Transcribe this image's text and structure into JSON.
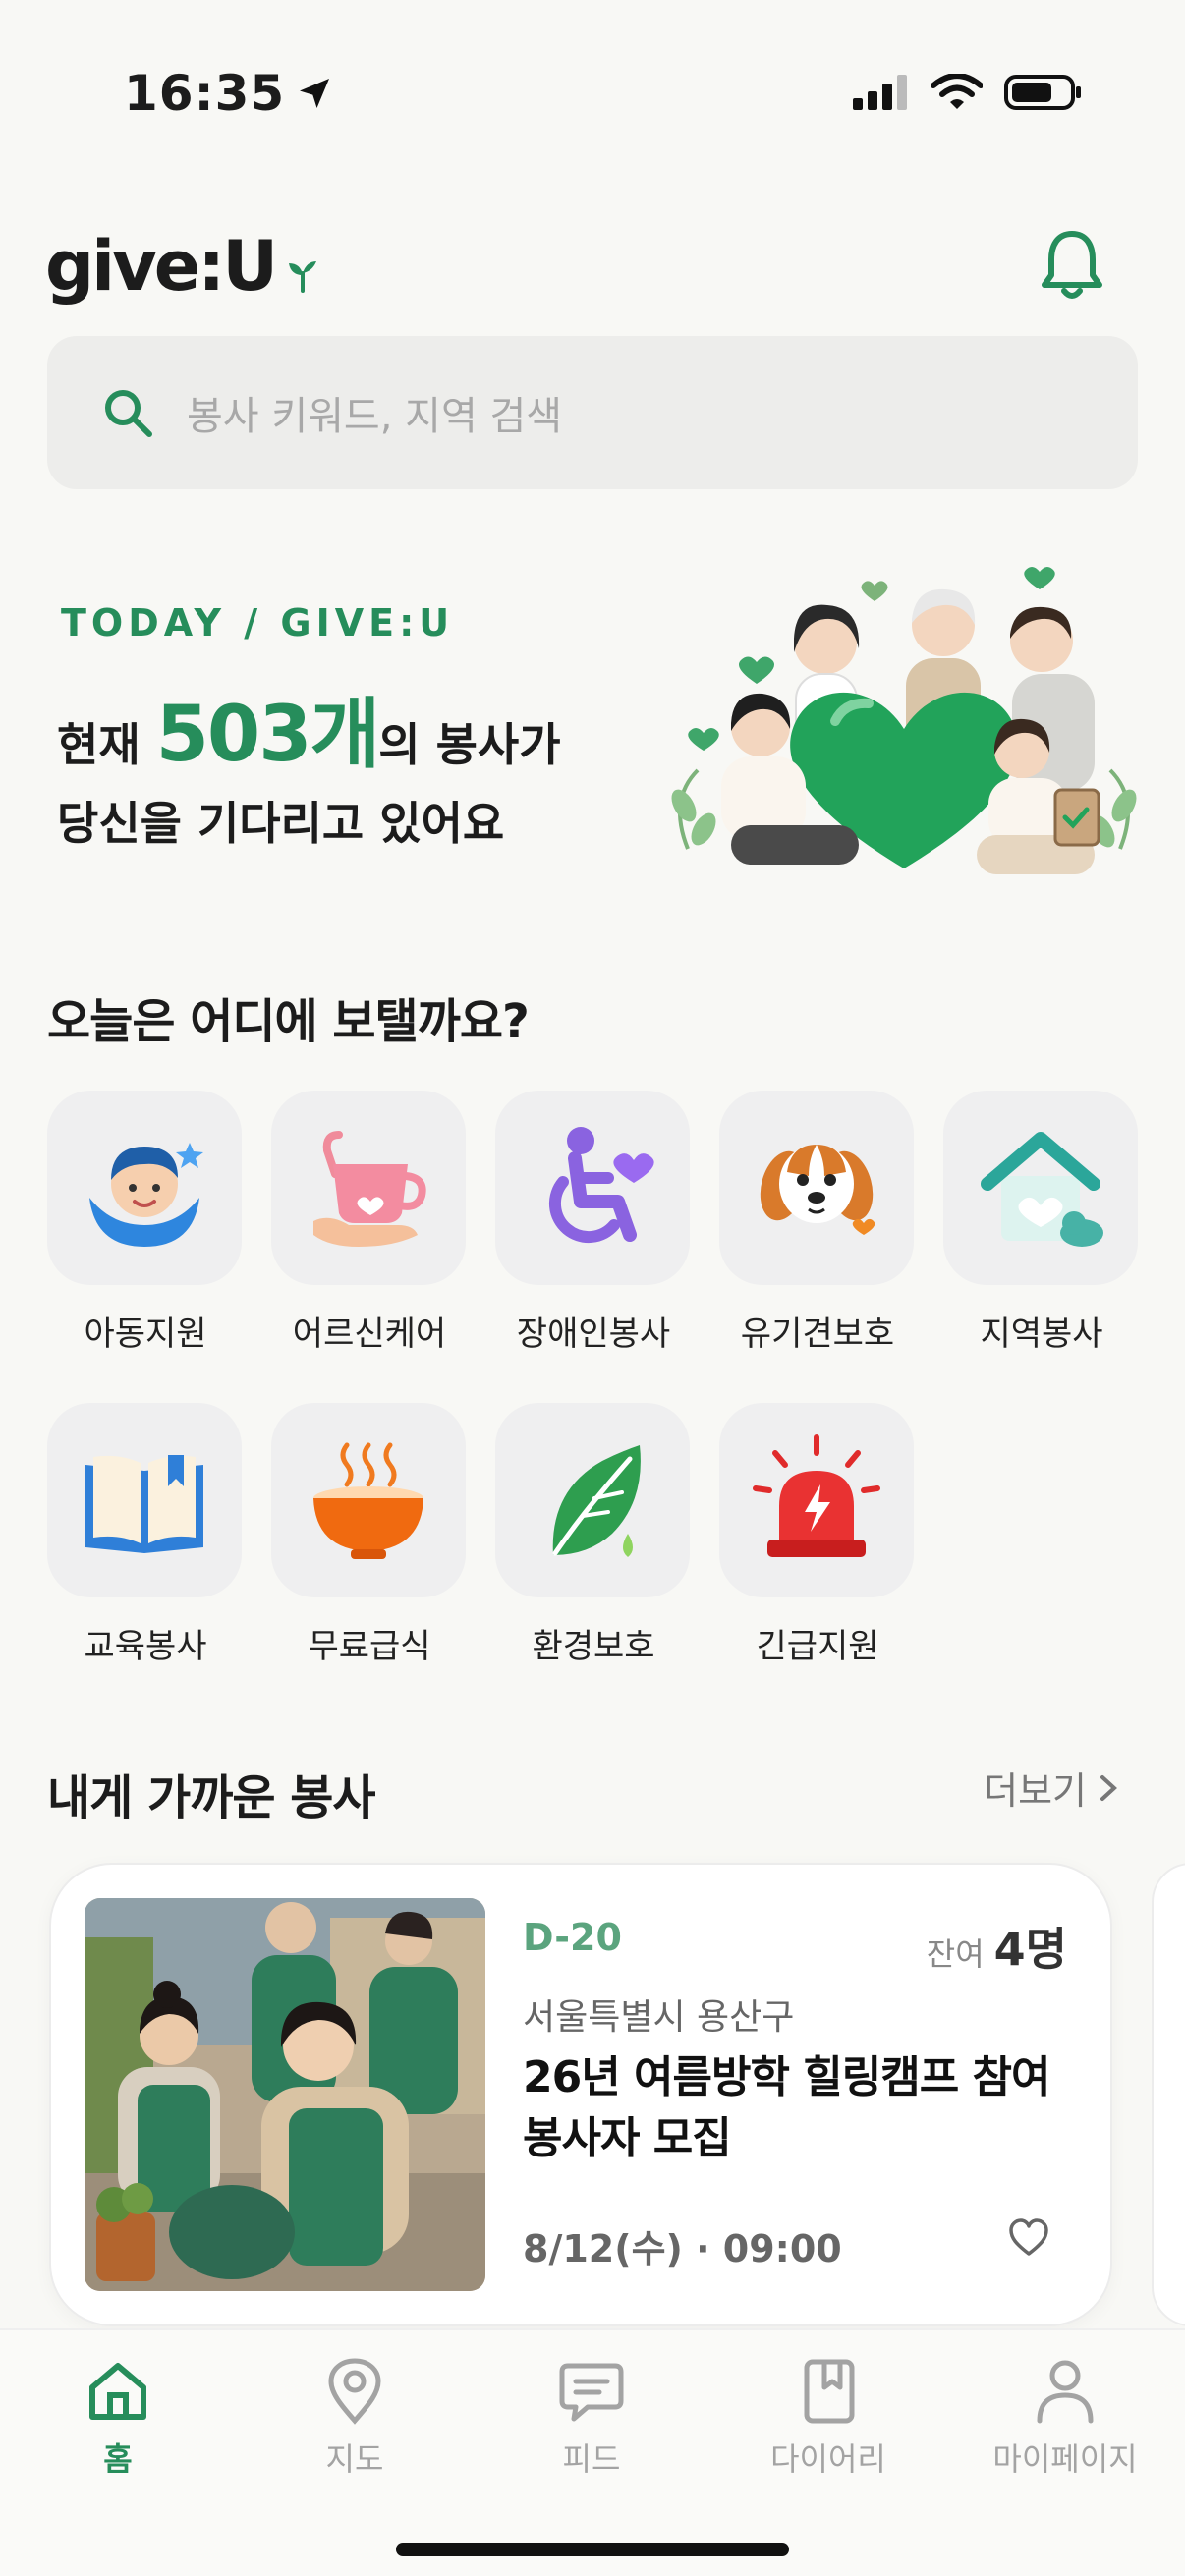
{
  "status": {
    "time": "16:35"
  },
  "header": {
    "logo": "give:U"
  },
  "search": {
    "placeholder": "봉사 키워드, 지역 검색"
  },
  "hero": {
    "eyebrow": "TODAY / GIVE:U",
    "line1_prefix": "현재 ",
    "count": "503개",
    "line1_suffix": "의 봉사가",
    "line2": "당신을 기다리고 있어요"
  },
  "categories": {
    "title": "오늘은 어디에 보탤까요?",
    "items": [
      {
        "label": "아동지원",
        "icon": "child-icon"
      },
      {
        "label": "어르신케어",
        "icon": "tea-cup-icon"
      },
      {
        "label": "장애인봉사",
        "icon": "wheelchair-icon"
      },
      {
        "label": "유기견보호",
        "icon": "puppy-icon"
      },
      {
        "label": "지역봉사",
        "icon": "house-icon"
      },
      {
        "label": "교육봉사",
        "icon": "book-icon"
      },
      {
        "label": "무료급식",
        "icon": "bowl-icon"
      },
      {
        "label": "환경보호",
        "icon": "leaf-icon"
      },
      {
        "label": "긴급지원",
        "icon": "siren-icon"
      }
    ]
  },
  "nearby": {
    "title": "내게 가까운 봉사",
    "more": "더보기",
    "card": {
      "dday": "D-20",
      "remain_label": "잔여",
      "remain_count": "4명",
      "location": "서울특별시 용산구",
      "title": "26년 여름방학 힐링캠프 참여 봉사자 모집",
      "date": "8/12(수) · 09:00"
    }
  },
  "tabs": [
    {
      "label": "홈",
      "icon": "home-icon",
      "active": true
    },
    {
      "label": "지도",
      "icon": "map-pin-icon",
      "active": false
    },
    {
      "label": "피드",
      "icon": "chat-bubble-icon",
      "active": false
    },
    {
      "label": "다이어리",
      "icon": "diary-icon",
      "active": false
    },
    {
      "label": "마이페이지",
      "icon": "person-icon",
      "active": false
    }
  ],
  "colors": {
    "accent": "#268D5B",
    "background": "#F8F8F5"
  }
}
